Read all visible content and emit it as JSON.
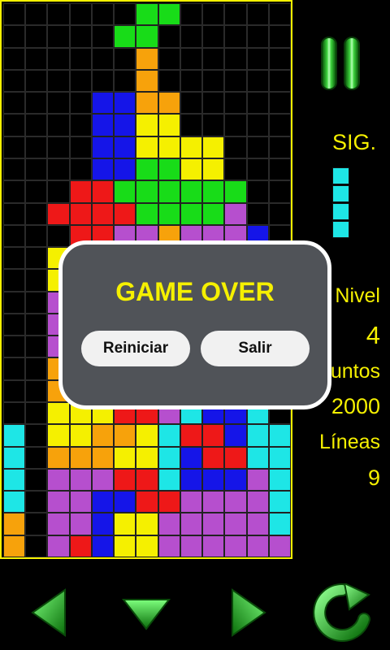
{
  "colors": {
    "board_border": "#f5f000",
    "text": "#f5f000",
    "cyan": "#1ee6e6",
    "orange": "#f7a20b",
    "blue": "#1515e8",
    "yellow": "#f5f000",
    "green": "#18dc18",
    "red": "#ee1818",
    "purple": "#b64fce",
    "dialog_bg": "#505358"
  },
  "board": {
    "columns": 13,
    "rows": 25,
    "cells": [
      "......GG.....",
      ".....GG......",
      "......O......",
      "......O......",
      "....BBOO.....",
      "....BBYY.....",
      "....BBYYYY...",
      "....BBGGYY...",
      "...RRGGGGGG..",
      "..RRRRGGGGP..",
      "...RRPPOPPPB.",
      "..YYPPPPPPPPB",
      "..YYPPPPPPPPB",
      "..PYPPPPPPPPB",
      "..PYPPPPPPPPB",
      "..PYPPPPPPPPB",
      "..OYPPPPPPPPB",
      "..OYPPPPPPPPB",
      "..YYYRRPCBBC.",
      "C.YYOOYCRRBCC",
      "C.OOOYYCBRRCC",
      "C.PPPRRCBBBPC",
      "C.PPBBRRPPPPC",
      "O.PPBYYPPPPPC",
      "O.PRBYYPPPPPP"
    ]
  },
  "next": {
    "label": "SIG.",
    "piece": "I",
    "color": "#1ee6e6"
  },
  "stats": {
    "level_label": "Nivel",
    "level_value": "4",
    "points_label": "untos",
    "points_value": "2000",
    "lines_label": "Líneas",
    "lines_value": "9"
  },
  "dialog": {
    "title": "GAME OVER",
    "restart_label": "Reiniciar",
    "exit_label": "Salir"
  },
  "controls": {
    "pause_icon": "pause-icon",
    "left_icon": "arrow-left-icon",
    "down_icon": "arrow-down-icon",
    "right_icon": "arrow-right-icon",
    "rotate_icon": "rotate-icon"
  }
}
